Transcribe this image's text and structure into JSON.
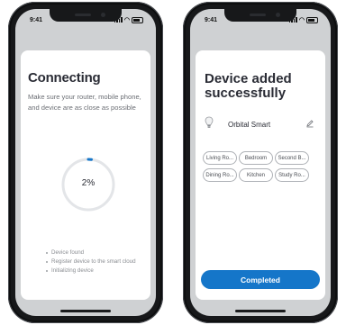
{
  "status_bar": {
    "time": "9:41"
  },
  "connecting": {
    "title": "Connecting",
    "description": "Make sure your router, mobile phone, and device are as close as possible",
    "progress_percent": 2,
    "progress_label": "2%",
    "steps": [
      "Device found",
      "Register device to the smart cloud",
      "Initializing device"
    ]
  },
  "added": {
    "title": "Device added successfully",
    "device_name": "Orbital Smart",
    "icons": {
      "device": "bulb-icon",
      "edit": "pencil-icon"
    },
    "rooms": [
      "Living Ro...",
      "Bedroom",
      "Second B...",
      "Dining Ro...",
      "Kitchen",
      "Study Ro..."
    ],
    "completed_label": "Completed"
  },
  "colors": {
    "accent": "#1576c9",
    "progress_track": "#e3e5e8"
  }
}
